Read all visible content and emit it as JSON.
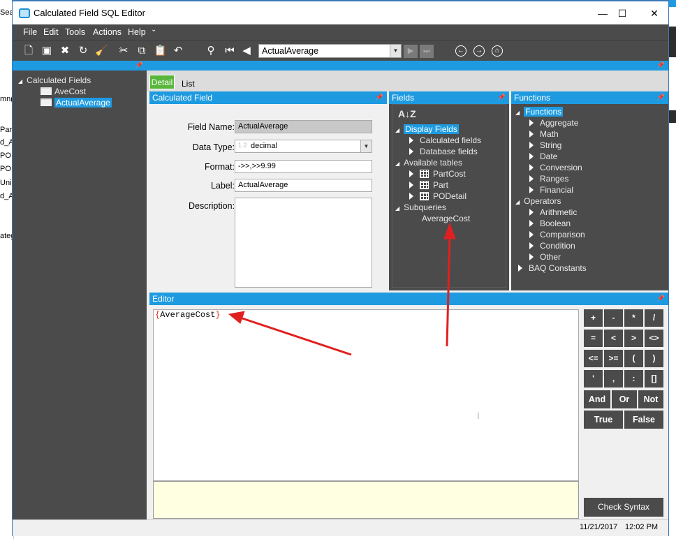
{
  "background_app": {
    "lines": [
      "Sea",
      "mn(",
      "Par",
      "d_A",
      "PO",
      "PO",
      "Uni",
      "d_A",
      "ateg"
    ]
  },
  "window": {
    "title": "Calculated Field SQL Editor",
    "minimize": "—",
    "maximize": "☐",
    "close": "✕"
  },
  "menu": [
    "File",
    "Edit",
    "Tools",
    "Actions",
    "Help"
  ],
  "toolbar": {
    "record_combo_value": "ActualAverage"
  },
  "left_tree": {
    "root": "Calculated Fields",
    "items": [
      {
        "label": "AveCost",
        "selected": false
      },
      {
        "label": "ActualAverage",
        "selected": true
      }
    ]
  },
  "tabs": {
    "detail": "Detail",
    "list": "List"
  },
  "calculated_field": {
    "header": "Calculated Field",
    "field_name_label": "Field Name:",
    "field_name_value": "ActualAverage",
    "data_type_label": "Data Type:",
    "data_type_value": "decimal",
    "format_label": "Format:",
    "format_value": "->>,>>9.99",
    "label_label": "Label:",
    "label_value": "ActualAverage",
    "description_label": "Description:"
  },
  "fields_panel": {
    "header": "Fields",
    "sort_icon": "az-sort-icon",
    "display_fields": "Display Fields",
    "calculated_fields": "Calculated fields",
    "database_fields": "Database fields",
    "available_tables": "Available tables",
    "tables": [
      "PartCost",
      "Part",
      "PODetail"
    ],
    "subqueries": "Subqueries",
    "subquery_items": [
      "AverageCost"
    ]
  },
  "functions_panel": {
    "header": "Functions",
    "functions": "Functions",
    "function_items": [
      "Aggregate",
      "Math",
      "String",
      "Date",
      "Conversion",
      "Ranges",
      "Financial"
    ],
    "operators": "Operators",
    "operator_items": [
      "Arithmetic",
      "Boolean",
      "Comparison",
      "Condition",
      "Other"
    ],
    "baq_constants": "BAQ Constants"
  },
  "editor": {
    "header": "Editor",
    "open_brace": "{",
    "expression_name": "AverageCost",
    "close_brace": "}"
  },
  "operators_grid": {
    "row1": [
      "+",
      "-",
      "*",
      "/"
    ],
    "row2": [
      "=",
      "<",
      ">",
      "<>"
    ],
    "row3": [
      "<=",
      ">=",
      "(",
      ")"
    ],
    "row4": [
      "'",
      ",",
      ":",
      "[]"
    ],
    "logic": [
      "And",
      "Or",
      "Not"
    ],
    "bool": [
      "True",
      "False"
    ],
    "check_syntax": "Check Syntax"
  },
  "status": {
    "date": "11/21/2017",
    "time": "12:02 PM"
  },
  "colors": {
    "accent_blue": "#1e9be0",
    "panel_dark": "#4b4b4b",
    "active_tab": "#58b63b",
    "annotation_arrow": "#e02020"
  }
}
